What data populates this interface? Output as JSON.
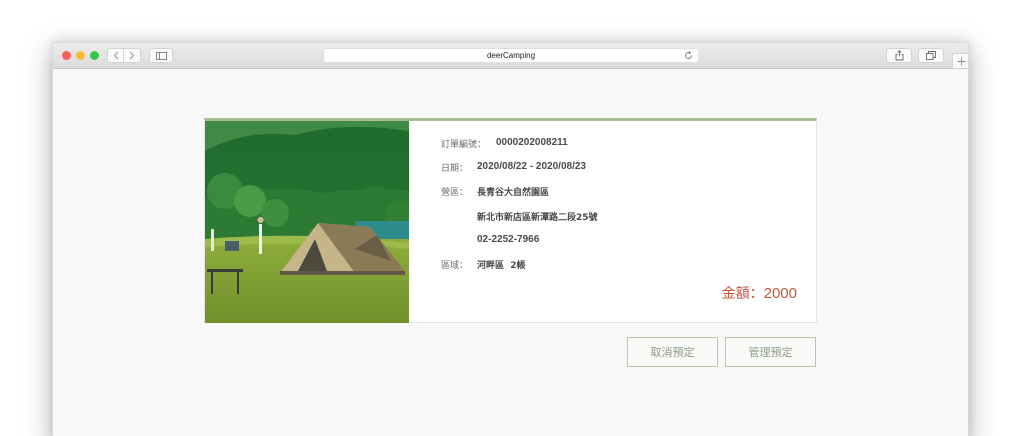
{
  "browser": {
    "address": "deerCamping"
  },
  "order": {
    "order_no_label": "訂單編號：",
    "order_no": "0000202008211",
    "date_label": "日期：",
    "date_range": "2020/08/22 - 2020/08/23",
    "camp_label": "營區：",
    "camp_name": "長青谷大自然園區",
    "address": "新北市新店區新潭路二段25號",
    "phone": "02-2252-7966",
    "area_label": "區域：",
    "area": "河畔區",
    "tents": "2帳",
    "amount_label": "金額：",
    "amount": "2000"
  },
  "actions": {
    "cancel_label": "取消預定",
    "manage_label": "管理預定"
  },
  "colors": {
    "accent": "#a7bf91",
    "amount": "#c2573c",
    "button_text": "#8c9a82"
  },
  "icons": [
    "back-icon",
    "forward-icon",
    "sidebar-icon",
    "reload-icon",
    "share-icon",
    "tabs-icon",
    "plus-icon"
  ]
}
